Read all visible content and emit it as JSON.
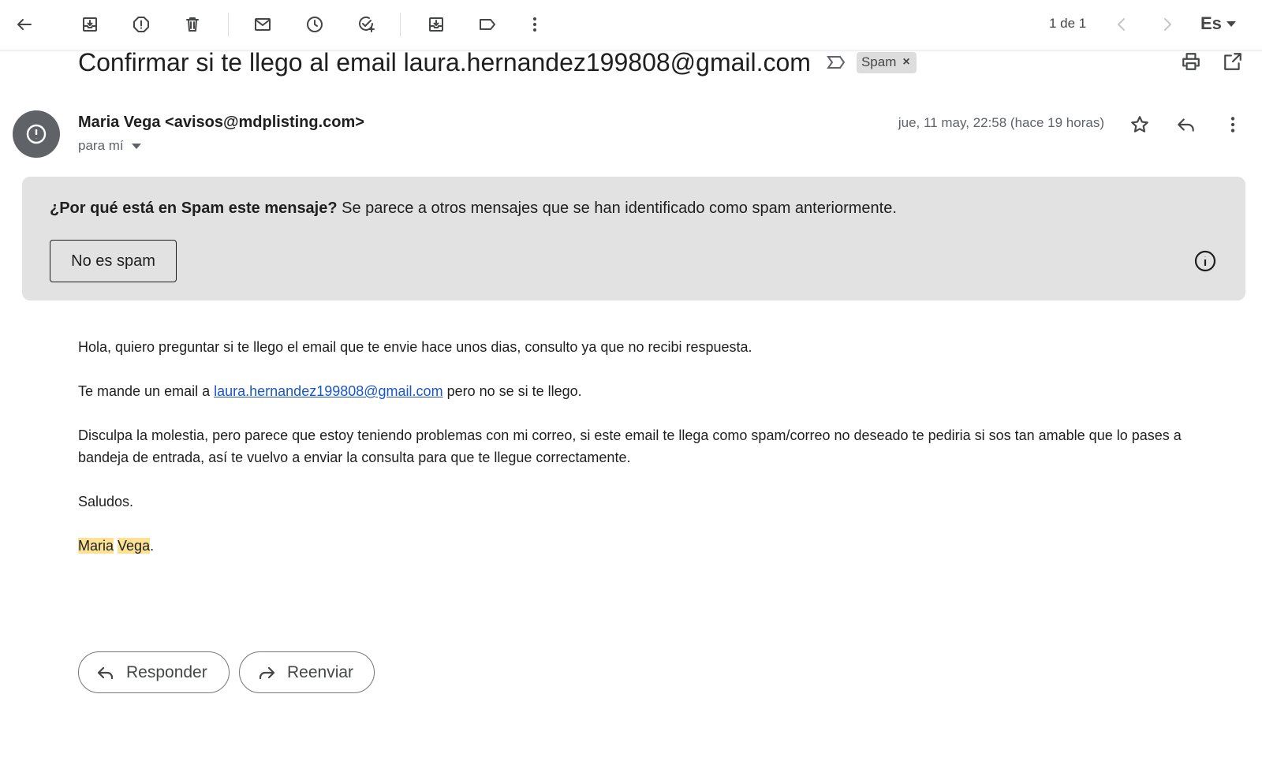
{
  "toolbar": {
    "icons": [
      "back-arrow-icon",
      "archive-icon",
      "report-spam-icon",
      "delete-icon",
      "mark-unread-icon",
      "snooze-icon",
      "add-task-icon",
      "move-to-icon",
      "label-icon",
      "more-vert-icon"
    ],
    "pager": "1 de 1",
    "language": "Es"
  },
  "email": {
    "subject": "Confirmar si te llego al email laura.hernandez199808@gmail.com",
    "label": "Spam",
    "label_remove": "×",
    "sender": "Maria Vega <avisos@mdplisting.com>",
    "recipient": "para mí",
    "date": "jue, 11 may, 22:58 (hace 19 horas)"
  },
  "spam_notice": {
    "question": "¿Por qué está en Spam este mensaje?",
    "reason": " Se parece a otros mensajes que se han identificado como spam anteriormente.",
    "button": "No es spam"
  },
  "body": {
    "p1": "Hola, quiero preguntar si te llego el email que te envie hace unos dias, consulto ya que no recibi respuesta.",
    "p2_before": "Te mande un email a ",
    "p2_link": "laura.hernandez199808@gmail.com",
    "p2_after": " pero no se si te llego.",
    "p3": "Disculpa la molestia, pero parece que estoy teniendo problemas con mi correo, si este email te llega como spam/correo no deseado te pediria si sos tan amable que lo pases a bandeja de entrada, así te vuelvo a enviar la consulta para que te llegue correctamente.",
    "p4": "Saludos.",
    "sig_first": "Maria",
    "sig_last": "Vega",
    "sig_end": "."
  },
  "actions": {
    "reply": "Responder",
    "forward": "Reenviar"
  },
  "colors": {
    "spam_box": "#e2e2e2",
    "link": "#1a56c9",
    "highlight": "#fde293",
    "avatar": "#5f6368"
  }
}
